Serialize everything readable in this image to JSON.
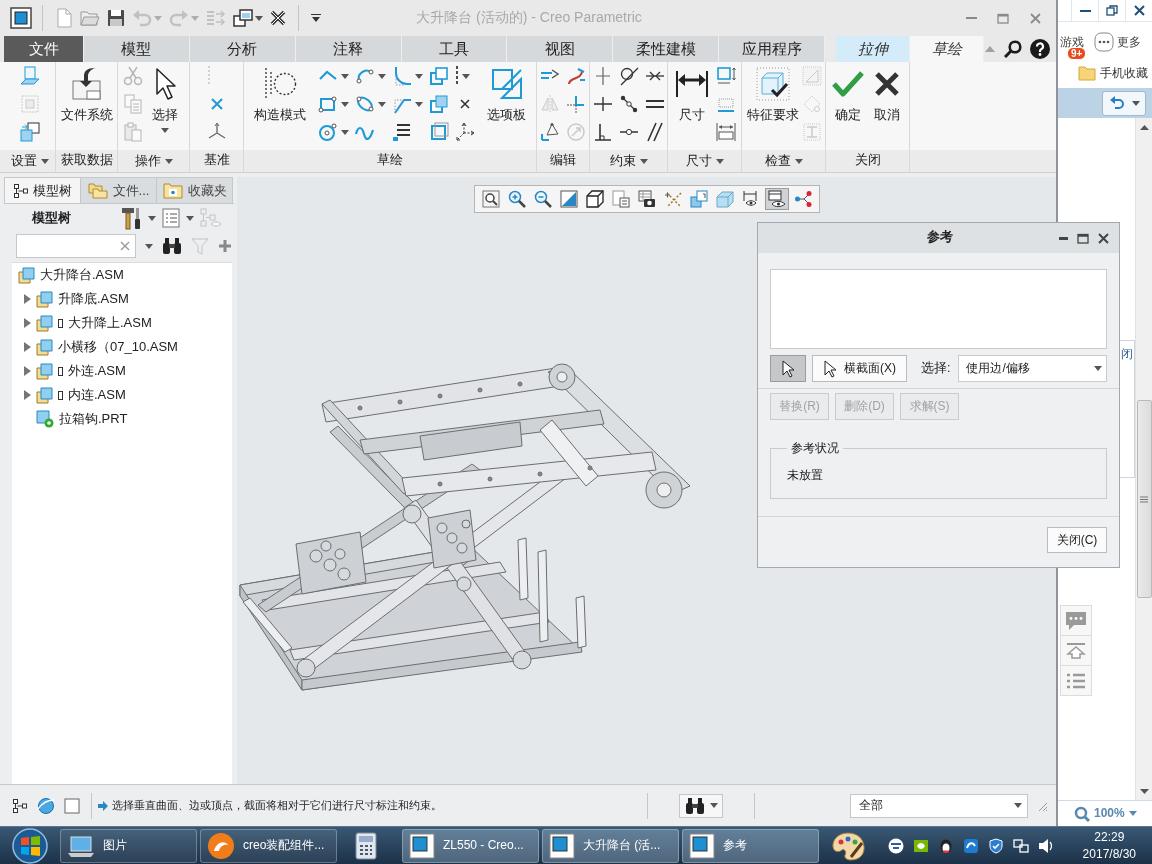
{
  "window": {
    "title": "大升降台 (活动的) - Creo Parametric"
  },
  "quick_access": [
    {
      "disabled": false
    },
    {
      "disabled": false
    },
    {
      "disabled": false
    },
    {
      "disabled": true,
      "menu": true
    },
    {
      "disabled": true,
      "menu": true
    },
    {
      "disabled": true
    },
    {
      "disabled": false,
      "menu": true
    },
    {
      "disabled": false
    }
  ],
  "ribbon_tabs": [
    {
      "label": "文件",
      "kind": "file",
      "selected": false
    },
    {
      "label": "模型",
      "kind": "main",
      "selected": false
    },
    {
      "label": "分析",
      "kind": "main",
      "selected": false
    },
    {
      "label": "注释",
      "kind": "main",
      "selected": false
    },
    {
      "label": "工具",
      "kind": "main",
      "selected": false
    },
    {
      "label": "视图",
      "kind": "main",
      "selected": false
    },
    {
      "label": "柔性建模",
      "kind": "main",
      "selected": false
    },
    {
      "label": "应用程序",
      "kind": "main",
      "selected": false
    },
    {
      "label": "拉伸",
      "kind": "context",
      "selected": false
    },
    {
      "label": "草绘",
      "kind": "context",
      "selected": true
    }
  ],
  "ribbon_groups": [
    {
      "label": "设置",
      "menu": true,
      "tools": [
        {
          "kind": "small",
          "disabled": false
        },
        {
          "kind": "small",
          "disabled": true
        },
        {
          "kind": "small",
          "disabled": false
        }
      ]
    },
    {
      "label": "获取数据",
      "tools": [
        {
          "kind": "large",
          "label": "文件系统",
          "disabled": false
        }
      ]
    },
    {
      "label": "操作",
      "menu": true,
      "tools": [
        {
          "kind": "small",
          "disabled": true
        },
        {
          "kind": "small",
          "disabled": true
        },
        {
          "kind": "small",
          "disabled": true
        },
        {
          "kind": "large",
          "label": "选择",
          "menu": true,
          "disabled": false
        }
      ]
    },
    {
      "label": "基准",
      "tools": [
        {
          "kind": "small",
          "disabled": true
        },
        {
          "kind": "small",
          "disabled": false
        },
        {
          "kind": "small",
          "disabled": false
        }
      ]
    },
    {
      "label": "草绘",
      "tools": [
        {
          "kind": "large",
          "label": "构造模式",
          "disabled": false
        },
        {
          "kind": "small",
          "menu": true,
          "disabled": false
        },
        {
          "kind": "small",
          "menu": true,
          "disabled": false
        },
        {
          "kind": "small",
          "menu": true,
          "disabled": false
        },
        {
          "kind": "small",
          "disabled": false
        },
        {
          "kind": "small",
          "menu": true,
          "disabled": false
        },
        {
          "kind": "small",
          "menu": true,
          "disabled": false
        },
        {
          "kind": "small",
          "menu": true,
          "disabled": false
        },
        {
          "kind": "small",
          "menu": true,
          "disabled": false
        },
        {
          "kind": "small",
          "disabled": false
        },
        {
          "kind": "small",
          "disabled": false
        },
        {
          "kind": "small",
          "menu": true,
          "disabled": false
        },
        {
          "kind": "small",
          "disabled": false
        },
        {
          "kind": "small",
          "disabled": false
        },
        {
          "kind": "small",
          "disabled": false
        },
        {
          "kind": "small",
          "disabled": false
        },
        {
          "kind": "large",
          "label": "选项板",
          "disabled": false
        }
      ]
    },
    {
      "label": "编辑",
      "tools": [
        {
          "kind": "small",
          "disabled": false
        },
        {
          "kind": "small",
          "disabled": false
        },
        {
          "kind": "small",
          "disabled": true
        },
        {
          "kind": "small",
          "disabled": false
        },
        {
          "kind": "small",
          "disabled": false
        },
        {
          "kind": "small",
          "disabled": true
        }
      ]
    },
    {
      "label": "约束",
      "menu": true,
      "tools": [
        {
          "kind": "small",
          "disabled": false
        },
        {
          "kind": "small",
          "disabled": false
        },
        {
          "kind": "small",
          "disabled": false
        },
        {
          "kind": "small",
          "disabled": false
        },
        {
          "kind": "small",
          "disabled": false
        },
        {
          "kind": "small",
          "disabled": false
        },
        {
          "kind": "small",
          "disabled": false
        },
        {
          "kind": "small",
          "disabled": false
        },
        {
          "kind": "small",
          "disabled": false
        }
      ]
    },
    {
      "label": "尺寸",
      "menu": true,
      "tools": [
        {
          "kind": "large",
          "label": "尺寸",
          "disabled": false
        },
        {
          "kind": "small",
          "disabled": false
        },
        {
          "kind": "small",
          "disabled": false
        },
        {
          "kind": "small",
          "disabled": false
        }
      ]
    },
    {
      "label": "检查",
      "menu": true,
      "tools": [
        {
          "kind": "large",
          "label": "特征要求",
          "disabled": false
        },
        {
          "kind": "small",
          "disabled": true
        },
        {
          "kind": "small",
          "disabled": true
        },
        {
          "kind": "small",
          "disabled": true
        }
      ]
    },
    {
      "label": "关闭",
      "tools": [
        {
          "kind": "large",
          "label": "确定",
          "disabled": false
        },
        {
          "kind": "large",
          "label": "取消",
          "disabled": false
        }
      ]
    }
  ],
  "model_panel": {
    "tabs": [
      {
        "label": "模型树",
        "selected": true
      },
      {
        "label": "文件...",
        "selected": false
      },
      {
        "label": "收藏夹",
        "selected": false
      }
    ],
    "title": "模型树",
    "tools": [
      {
        "menu": true,
        "disabled": false
      },
      {
        "menu": true,
        "disabled": false
      },
      {
        "disabled": true
      }
    ],
    "search_tools": [
      {
        "disabled": false
      },
      {
        "disabled": true
      },
      {
        "disabled": false
      }
    ],
    "tree": {
      "label": "大升降台.ASM",
      "kind": "assembly",
      "children": [
        {
          "label": "升降底.ASM",
          "kind": "assembly",
          "expanded": false,
          "marked": false
        },
        {
          "label": "大升降上.ASM",
          "kind": "assembly",
          "expanded": false,
          "marked": true
        },
        {
          "label": "小横移（07_10.ASM",
          "kind": "assembly",
          "expanded": false,
          "marked": false
        },
        {
          "label": "外连.ASM",
          "kind": "assembly",
          "expanded": false,
          "marked": true
        },
        {
          "label": "内连.ASM",
          "kind": "assembly",
          "expanded": false,
          "marked": true
        },
        {
          "label": "拉箱钩.PRT",
          "kind": "part",
          "marked": false
        }
      ]
    }
  },
  "view_toolbar": [
    {
      "selected": false
    },
    {
      "selected": false
    },
    {
      "selected": false
    },
    {
      "selected": false
    },
    {
      "selected": false
    },
    {
      "selected": false
    },
    {
      "selected": false
    },
    {
      "selected": false
    },
    {
      "selected": false
    },
    {
      "selected": false
    },
    {
      "selected": false
    },
    {
      "selected": true
    },
    {
      "selected": false
    }
  ],
  "reference_dialog": {
    "title": "参考",
    "pick_buttons": [
      {
        "kind": "pointer",
        "selected": true
      },
      {
        "kind": "section",
        "label": "横截面(X)",
        "selected": false
      }
    ],
    "select_label": "选择:",
    "select_value": "使用边/偏移",
    "actions": [
      {
        "label": "替换(R)",
        "disabled": true
      },
      {
        "label": "删除(D)",
        "disabled": true
      },
      {
        "label": "求解(S)",
        "disabled": true
      }
    ],
    "status_title": "参考状况",
    "status_text": "未放置",
    "close_button": "关闭(C)"
  },
  "status_bar": {
    "message": "选择垂直曲面、边或顶点，截面将相对于它们进行尺寸标注和约束。",
    "filter": "全部"
  },
  "browser": {
    "games": "游戏",
    "badge": "9+",
    "more": "更多",
    "favorites": "手机收藏",
    "page_text": "闭",
    "zoom": "100%"
  },
  "taskbar": {
    "items": [
      {
        "kind": "window",
        "label": "图片",
        "active": false
      },
      {
        "kind": "window",
        "label": "creo装配组件...",
        "active": false
      },
      {
        "kind": "pinned",
        "active": false
      },
      {
        "kind": "window",
        "label": "ZL550 - Creo...",
        "active": true
      },
      {
        "kind": "window",
        "label": "大升降台 (活...",
        "active": true
      },
      {
        "kind": "window",
        "label": "参考",
        "active": true
      },
      {
        "kind": "pinned",
        "active": false
      }
    ],
    "time": "22:29",
    "date": "2017/8/30"
  }
}
